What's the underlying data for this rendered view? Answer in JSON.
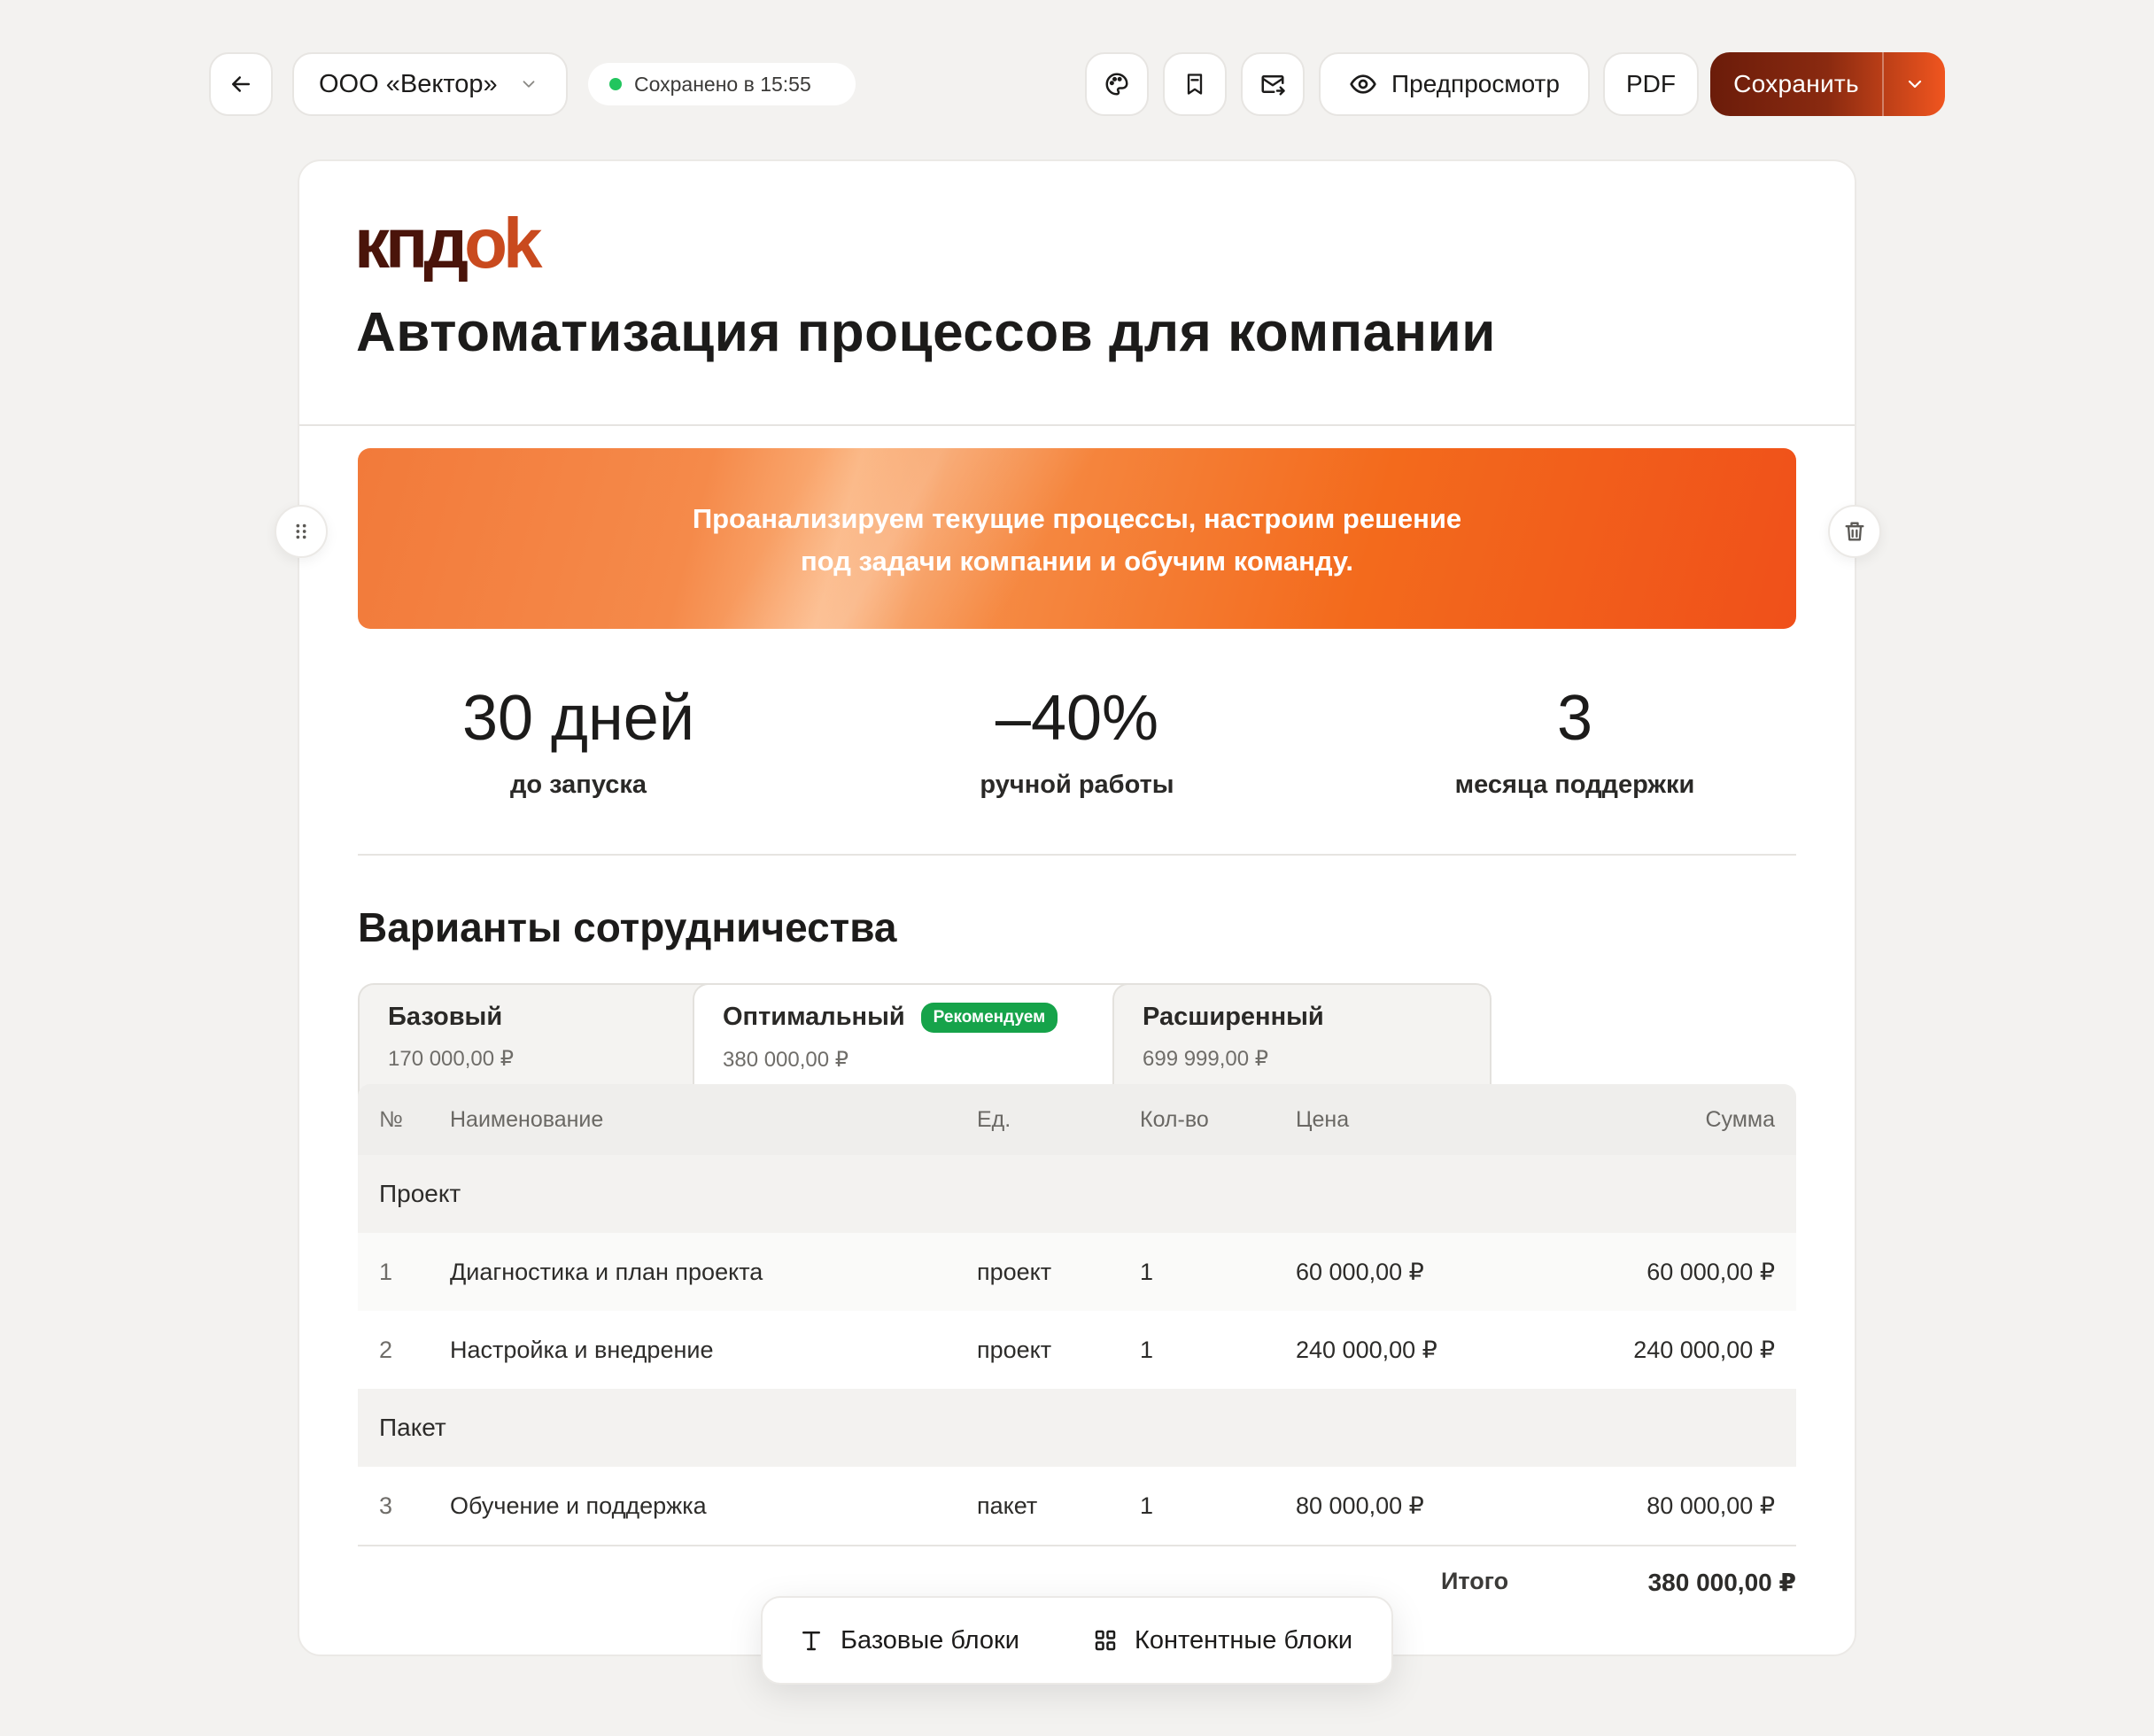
{
  "toolbar": {
    "company": "ООО «Вектор»",
    "saved_status": "Сохранено в 15:55",
    "preview_label": "Предпросмотр",
    "pdf_label": "PDF",
    "save_label": "Сохранить"
  },
  "document": {
    "logo_part1": "кпд",
    "logo_part2": "ok",
    "title": "Автоматизация процессов для компании",
    "banner_line1": "Проанализируем текущие процессы, настроим решение",
    "banner_line2": "под задачи компании и обучим команду.",
    "stats": [
      {
        "value": "30 дней",
        "label": "до запуска"
      },
      {
        "value": "–40%",
        "label": "ручной работы"
      },
      {
        "value": "3",
        "label": "месяца поддержки"
      }
    ],
    "section_title": "Варианты сотрудничества",
    "tabs": [
      {
        "name": "Базовый",
        "price": "170 000,00 ₽"
      },
      {
        "name": "Оптимальный",
        "price": "380 000,00 ₽",
        "badge": "Рекомендуем"
      },
      {
        "name": "Расширенный",
        "price": "699 999,00 ₽"
      }
    ],
    "table": {
      "headers": {
        "num": "№",
        "name": "Наименование",
        "unit": "Ед.",
        "qty": "Кол-во",
        "price": "Цена",
        "sum": "Сумма"
      },
      "groups": [
        {
          "title": "Проект",
          "rows": [
            {
              "num": "1",
              "name": "Диагностика и план проекта",
              "unit": "проект",
              "qty": "1",
              "price": "60 000,00 ₽",
              "sum": "60 000,00 ₽"
            },
            {
              "num": "2",
              "name": "Настройка и внедрение",
              "unit": "проект",
              "qty": "1",
              "price": "240 000,00 ₽",
              "sum": "240 000,00 ₽"
            }
          ]
        },
        {
          "title": "Пакет",
          "rows": [
            {
              "num": "3",
              "name": "Обучение и поддержка",
              "unit": "пакет",
              "qty": "1",
              "price": "80 000,00 ₽",
              "sum": "80 000,00 ₽"
            }
          ]
        }
      ],
      "total_label": "Итого",
      "total_value": "380 000,00 ₽"
    }
  },
  "blocks_bar": {
    "basic_label": "Базовые блоки",
    "content_label": "Контентные блоки"
  },
  "colors": {
    "accent_dark": "#6b1c0a",
    "accent_orange": "#f0551f",
    "badge_green": "#16a34a",
    "status_green": "#22c55e"
  },
  "icons": [
    "arrow-left-icon",
    "chevron-down-icon",
    "palette-icon",
    "bookmark-icon",
    "mail-icon",
    "eye-icon",
    "drag-handle-icon",
    "trash-icon",
    "text-icon",
    "grid-icon"
  ]
}
